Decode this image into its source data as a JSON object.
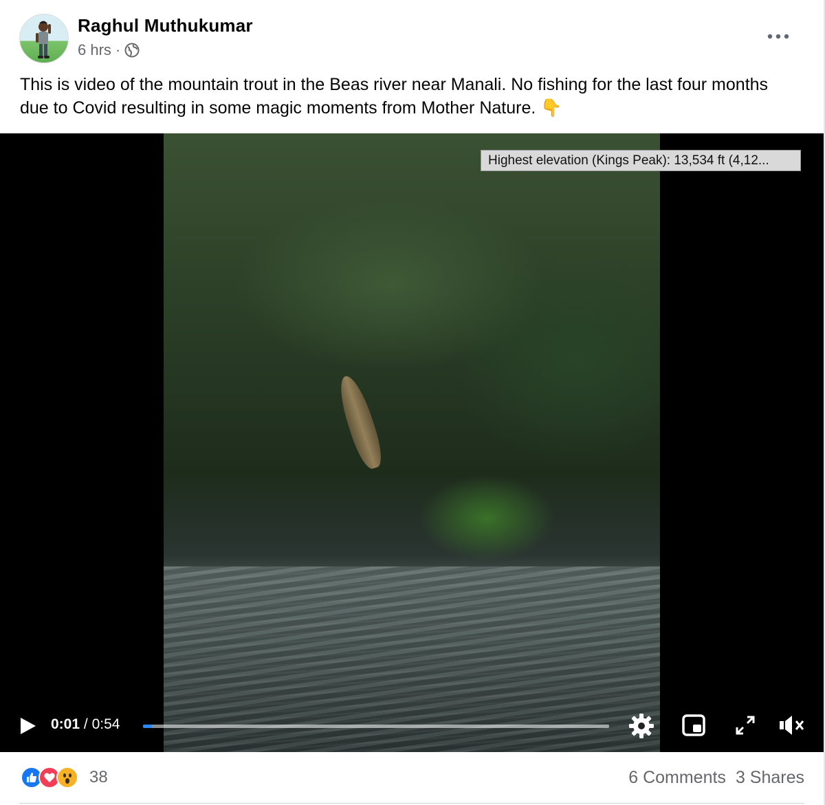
{
  "post": {
    "author": "Raghul Muthukumar",
    "time": "6 hrs",
    "dot": "·",
    "privacy_icon": "globe-icon",
    "caption": "This is video of the mountain trout in the Beas river near Manali. No fishing for the last four months due to Covid resulting in some magic moments from Mother Nature. 👇"
  },
  "video": {
    "overlay_label": "Highest elevation (Kings Peak): 13,534 ft (4,12...",
    "current_time": "0:01",
    "separator": "/",
    "duration": "0:54",
    "progress_fraction": 0.019,
    "accent_color": "#2d88ff"
  },
  "footer": {
    "reactions": [
      "like-reaction-icon",
      "love-reaction-icon",
      "wow-reaction-icon"
    ],
    "reaction_count": "38",
    "comments": "6 Comments",
    "shares": "3 Shares"
  },
  "colors": {
    "like": "#1877f2",
    "love": "#f33e58",
    "wow": "#f7b125",
    "secondary_text": "#65676b"
  }
}
